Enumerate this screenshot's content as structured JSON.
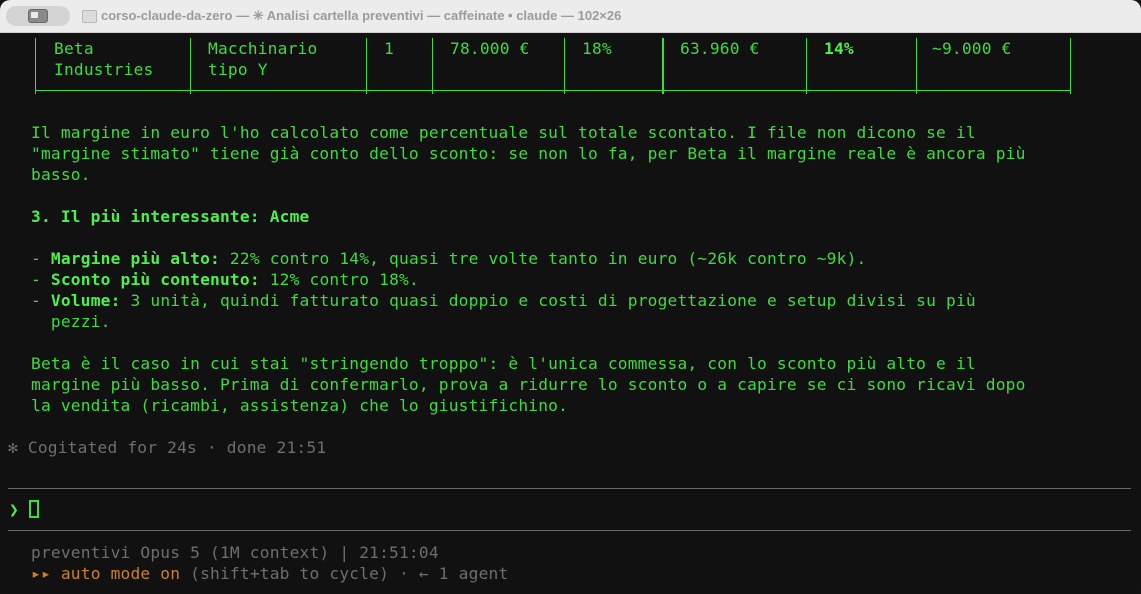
{
  "window": {
    "title": "corso-claude-da-zero — ✳ Analisi cartella preventivi — caffeinate • claude — 102×26"
  },
  "table": {
    "row": [
      [
        "Beta",
        "Macchinario",
        "1",
        "78.000 €",
        "18%",
        "63.960 €",
        "14%",
        "~9.000 €"
      ],
      [
        "Industries",
        "tipo Y",
        "",
        "",
        "",
        "",
        "",
        ""
      ]
    ]
  },
  "body": {
    "para1": [
      "Il margine in euro l'ho calcolato come percentuale sul totale scontato. I file non dicono se il",
      "\"margine stimato\" tiene già conto dello sconto: se non lo fa, per Beta il margine reale è ancora più",
      "basso."
    ],
    "heading": "3. Il più interessante: Acme",
    "bullets": [
      {
        "dash": "- ",
        "label": "Margine più alto:",
        "text": " 22% contro 14%, quasi tre volte tanto in euro (~26k contro ~9k)."
      },
      {
        "dash": "- ",
        "label": "Sconto più contenuto:",
        "text": " 12% contro 18%."
      },
      {
        "dash": "- ",
        "label": "Volume:",
        "text": " 3 unità, quindi fatturato quasi doppio e costi di progettazione e setup divisi su più"
      }
    ],
    "bullet3_cont": "  pezzi.",
    "para2": [
      "Beta è il caso in cui stai \"stringendo troppo\": è l'unica commessa, con lo sconto più alto e il",
      "margine più basso. Prima di confermarlo, prova a ridurre lo sconto o a capire se ci sono ricavi dopo",
      "la vendita (ricambi, assistenza) che lo giustifichino."
    ]
  },
  "status": {
    "cogitated": "✻ Cogitated for 24s · done 21:51"
  },
  "prompt": {
    "symbol": "❯"
  },
  "footer": {
    "line1": "preventivi Opus 5 (1M context) | 21:51:04",
    "arrows": "▸▸",
    "mode": " auto mode on",
    "hint": " (shift+tab to cycle) · ← 1 agent"
  },
  "colors": {
    "terminal_green": "#3ddc3d",
    "background": "#111111",
    "dim": "#6e6e6e",
    "accent_orange": "#c9822c"
  }
}
